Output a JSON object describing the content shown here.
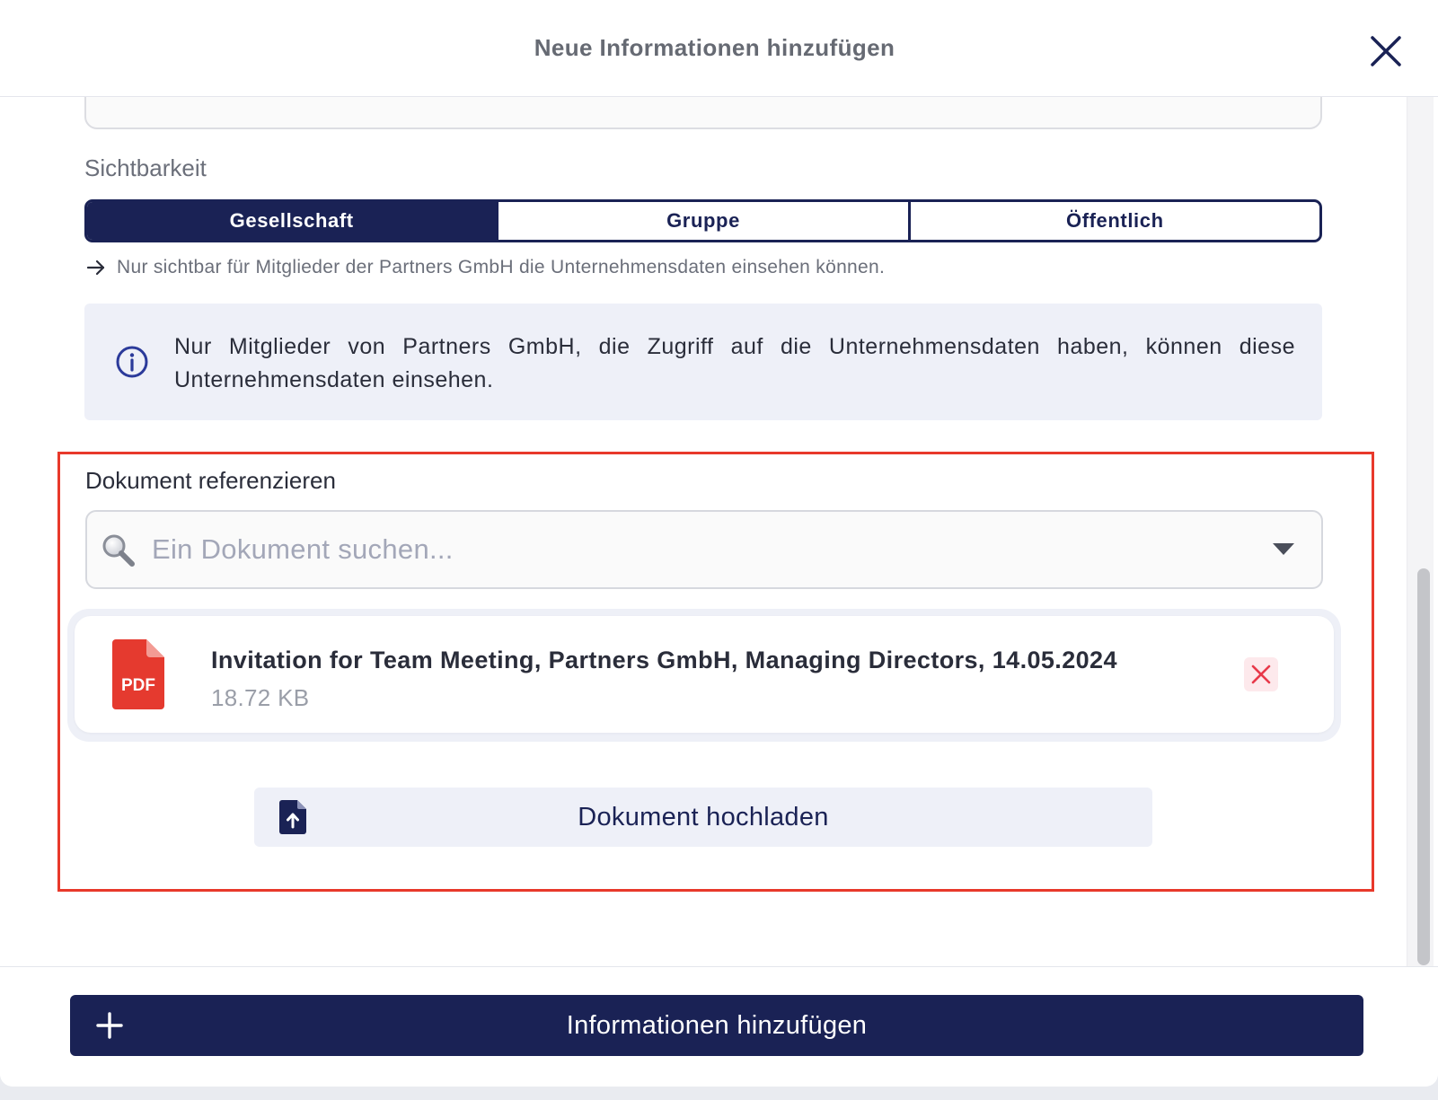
{
  "modal": {
    "title": "Neue Informationen hinzufügen"
  },
  "visibility": {
    "label": "Sichtbarkeit",
    "options": [
      "Gesellschaft",
      "Gruppe",
      "Öffentlich"
    ],
    "selected": "Gesellschaft",
    "hint": "Nur sichtbar für Mitglieder der Partners GmbH die Unternehmensdaten einsehen können."
  },
  "info": {
    "text": "Nur Mitglieder von Partners GmbH, die Zugriff auf die Unternehmensdaten haben, können diese Unternehmensdaten einsehen."
  },
  "document": {
    "label": "Dokument referenzieren",
    "search_placeholder": "Ein Dokument suchen...",
    "file": {
      "type_badge": "PDF",
      "name": "Invitation for Team Meeting, Partners GmbH, Managing Directors, 14.05.2024",
      "size": "18.72 KB"
    },
    "upload_label": "Dokument hochladen"
  },
  "footer": {
    "submit_label": "Informationen hinzufügen"
  },
  "colors": {
    "primary": "#1a2255",
    "highlight_border": "#e8392b",
    "pdf_red": "#e53a2f",
    "info_bg": "#eef0f8"
  }
}
